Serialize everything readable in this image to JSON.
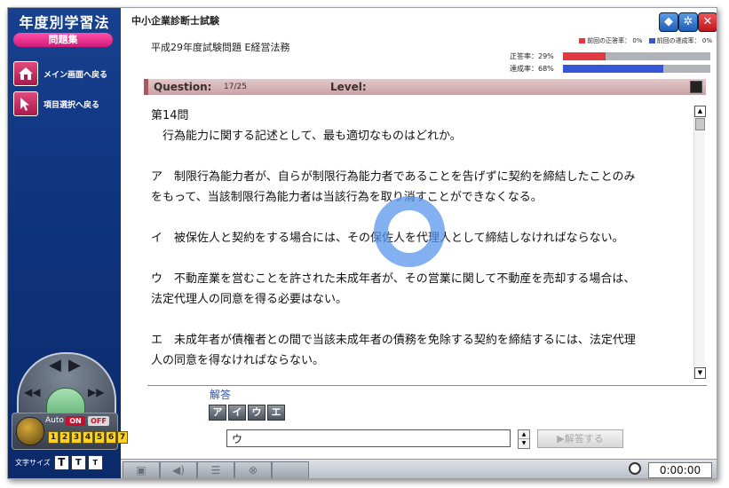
{
  "sidebar": {
    "app_title": "年度別学習法",
    "app_subtitle": "問題集",
    "nav": [
      {
        "label": "メイン画面へ戻る",
        "icon": "home-icon"
      },
      {
        "label": "項目選択へ戻る",
        "icon": "cursor-icon"
      }
    ],
    "controls": {
      "auto_label": "Auto",
      "on_label": "ON",
      "off_label": "OFF",
      "speeds": [
        "1",
        "2",
        "3",
        "4",
        "5",
        "6",
        "7"
      ],
      "font_size_label": "文字サイズ",
      "font_buttons": [
        "T",
        "T",
        "T"
      ]
    }
  },
  "header": {
    "exam_title": "中小企業診断士試験",
    "subject": "平成29年度試験問題 E経営法務",
    "window_buttons": [
      "cube-icon",
      "gear-icon",
      "close-icon"
    ]
  },
  "stats": {
    "legend_correct": "前回の正答率：",
    "legend_correct_value": "0%",
    "legend_achieve": "前回の達成率：",
    "legend_achieve_value": "0%",
    "correct_label": "正答率：",
    "correct_value": "29%",
    "correct_fraction": 0.29,
    "achieve_label": "達成率：",
    "achieve_value": "68%",
    "achieve_fraction": 0.68,
    "colors": {
      "correct": "#e0393f",
      "achieve": "#3557d6",
      "track": "#b0b3b8"
    }
  },
  "question_bar": {
    "label": "Question:",
    "number": "17/25",
    "level_label": "Level:"
  },
  "question": {
    "title": "第14問",
    "stem": "行為能力に関する記述として、最も適切なものはどれか。",
    "choices": [
      {
        "line1": "ア　制限行為能力者が、自らが制限行為能力者であることを告げずに契約を締結したことのみ",
        "line2": "をもって、当該制限行為能力者は当該行為を取り消すことができなくなる。"
      },
      {
        "line1": "イ　被保佐人と契約をする場合には、その保佐人を代理人として締結しなければならない。",
        "line2": ""
      },
      {
        "line1": "ウ　不動産業を営むことを許された未成年者が、その営業に関して不動産を売却する場合は、",
        "line2": "法定代理人の同意を得る必要はない。"
      },
      {
        "line1": "エ　未成年者が債権者との間で当該未成年者の債務を免除する契約を締結するには、法定代理",
        "line2": "人の同意を得なければならない。"
      }
    ]
  },
  "answer": {
    "label": "解答",
    "kana": [
      "ア",
      "イ",
      "ウ",
      "エ"
    ],
    "value": "ウ",
    "submit_label": "▶解答する"
  },
  "bottom": {
    "timer": "0:00:00"
  }
}
